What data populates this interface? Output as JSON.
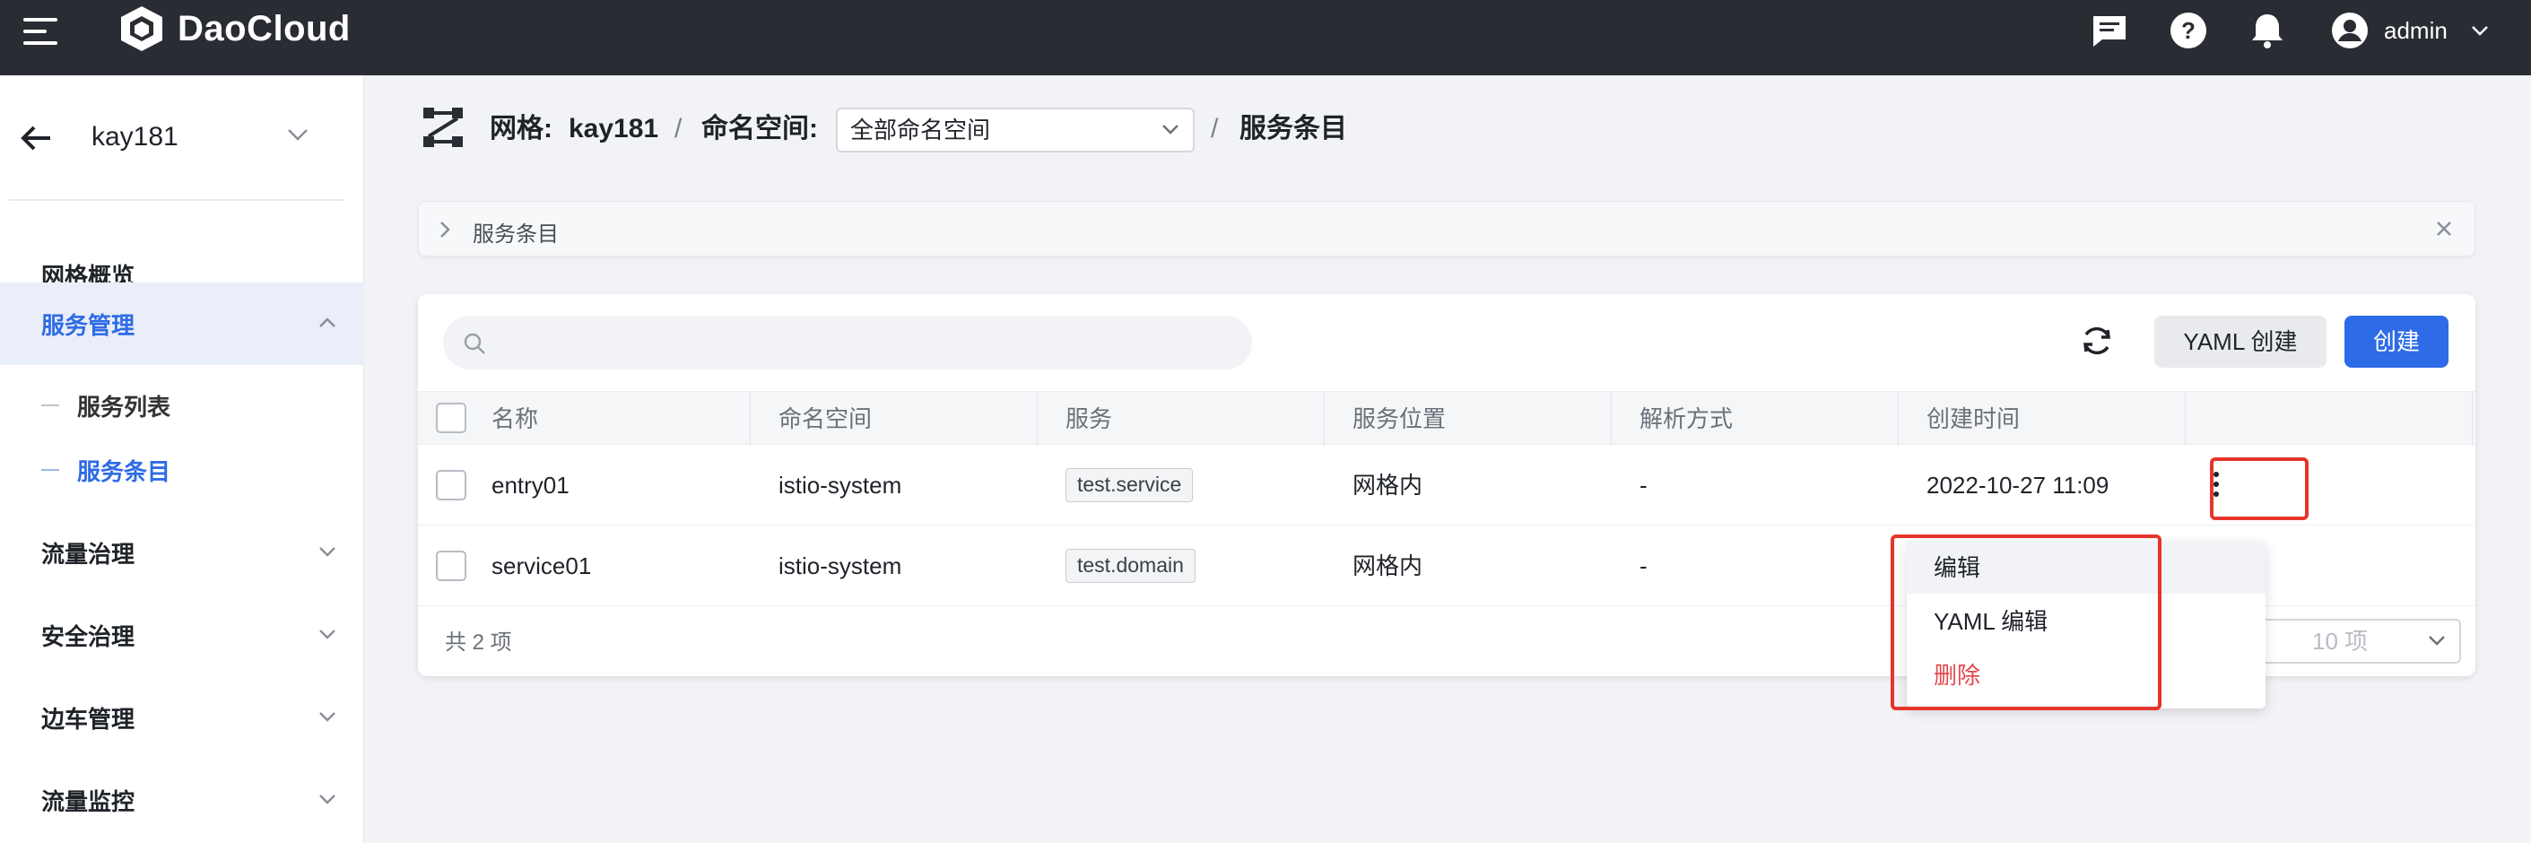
{
  "topbar": {
    "brand": "DaoCloud",
    "user": "admin",
    "icons": [
      "menu-icon",
      "message-icon",
      "help-icon",
      "bell-icon",
      "user-icon",
      "chevron-down-icon"
    ]
  },
  "sidebar": {
    "title": "kay181",
    "items": [
      {
        "label": "网格概览"
      },
      {
        "label": "服务管理"
      },
      {
        "label": "流量治理"
      },
      {
        "label": "安全治理"
      },
      {
        "label": "边车管理"
      },
      {
        "label": "流量监控"
      }
    ],
    "sub_items": [
      {
        "label": "服务列表"
      },
      {
        "label": "服务条目"
      }
    ]
  },
  "header": {
    "mesh_label": "网格:",
    "mesh_name": "kay181",
    "sep": "/",
    "ns_label": "命名空间:",
    "ns_value": "全部命名空间",
    "page": "服务条目"
  },
  "collapse": {
    "label": "服务条目"
  },
  "toolbar": {
    "search_placeholder": "",
    "yaml_create": "YAML 创建",
    "create": "创建"
  },
  "table": {
    "columns": [
      "名称",
      "命名空间",
      "服务",
      "服务位置",
      "解析方式",
      "创建时间"
    ],
    "rows": [
      {
        "name": "entry01",
        "namespace": "istio-system",
        "service": "test.service",
        "location": "网格内",
        "resolution": "-",
        "created": "2022-10-27 11:09"
      },
      {
        "name": "service01",
        "namespace": "istio-system",
        "service": "test.domain",
        "location": "网格内",
        "resolution": "-",
        "created": ""
      }
    ],
    "total": "共 2 项",
    "page_size": "10 项"
  },
  "menu": {
    "items": [
      {
        "label": "编辑"
      },
      {
        "label": "YAML 编辑"
      },
      {
        "label": "删除"
      }
    ]
  },
  "colors": {
    "topbar": "#2a2c33",
    "accent": "#2e6be6",
    "danger": "#e5484d",
    "highlight": "#e6352b"
  }
}
